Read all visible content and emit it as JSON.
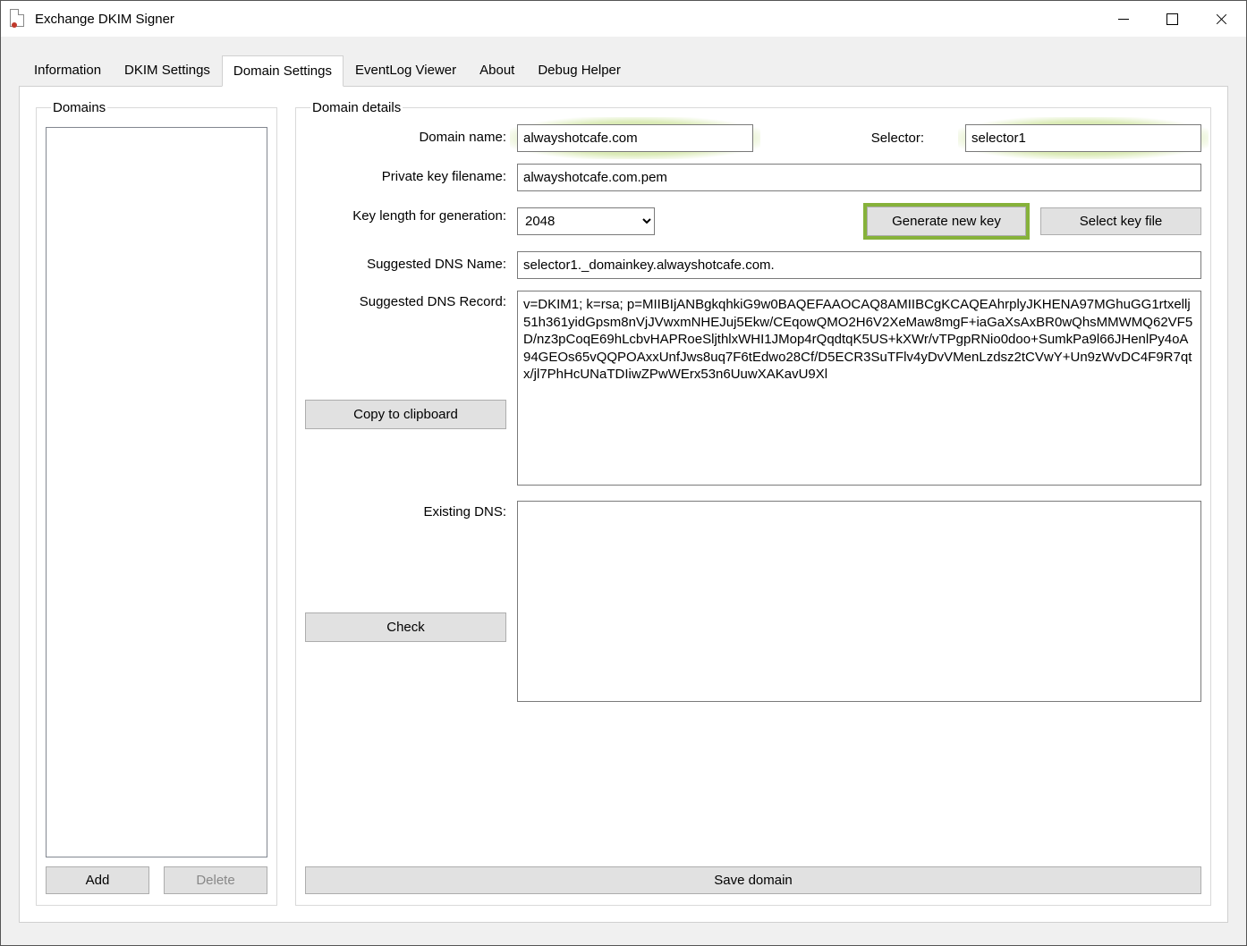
{
  "window": {
    "title": "Exchange DKIM Signer"
  },
  "tabs": {
    "information": "Information",
    "dkim_settings": "DKIM Settings",
    "domain_settings": "Domain Settings",
    "eventlog_viewer": "EventLog Viewer",
    "about": "About",
    "debug_helper": "Debug Helper"
  },
  "domains_panel": {
    "legend": "Domains",
    "add_label": "Add",
    "delete_label": "Delete"
  },
  "details": {
    "legend": "Domain details",
    "domain_name_label": "Domain name:",
    "domain_name_value": "alwayshotcafe.com",
    "selector_label": "Selector:",
    "selector_value": "selector1",
    "private_key_label": "Private key filename:",
    "private_key_value": "alwayshotcafe.com.pem",
    "key_length_label": "Key length for generation:",
    "key_length_value": "2048",
    "generate_label": "Generate new key",
    "select_keyfile_label": "Select key file",
    "dns_name_label": "Suggested DNS Name:",
    "dns_name_value": "selector1._domainkey.alwayshotcafe.com.",
    "dns_record_label": "Suggested DNS Record:",
    "dns_record_value": "v=DKIM1; k=rsa; p=MIIBIjANBgkqhkiG9w0BAQEFAAOCAQ8AMIIBCgKCAQEAhrplyJKHENA97MGhuGG1rtxellj51h361yidGpsm8nVjJVwxmNHEJuj5Ekw/CEqowQMO2H6V2XeMaw8mgF+iaGaXsAxBR0wQhsMMWMQ62VF5D/nz3pCoqE69hLcbvHAPRoeSljthlxWHI1JMop4rQqdtqK5US+kXWr/vTPgpRNio0doo+SumkPa9l66JHenlPy4oA94GEOs65vQQPOAxxUnfJws8uq7F6tEdwo28Cf/D5ECR3SuTFlv4yDvVMenLzdsz2tCVwY+Un9zWvDC4F9R7qtx/jl7PhHcUNaTDIiwZPwWErx53n6UuwXAKavU9Xl",
    "copy_label": "Copy to clipboard",
    "existing_dns_label": "Existing DNS:",
    "existing_dns_value": "",
    "check_label": "Check",
    "save_label": "Save domain"
  }
}
